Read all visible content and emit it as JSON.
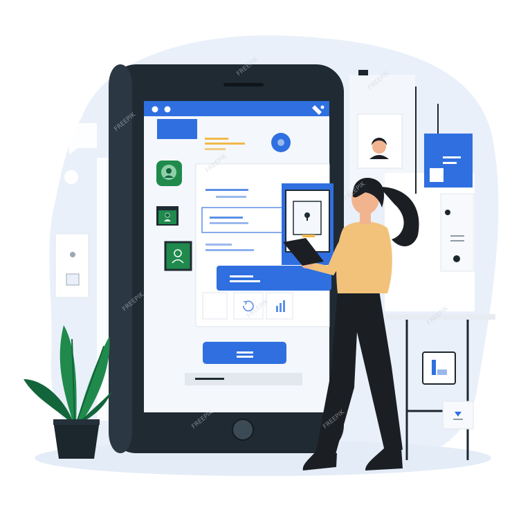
{
  "colors": {
    "background": "#ffffff",
    "backdrop_blob": "#e9f0fa",
    "phone_body": "#1f2a33",
    "phone_edge": "#2b3742",
    "screen": "#f4f7fb",
    "accent_blue": "#2f6fe0",
    "light_blue": "#5b8fe8",
    "line_grey": "#c9d2dc",
    "yellow_accent": "#f2b84b",
    "plant_green": "#1f8a4c",
    "plant_dark": "#12653a",
    "pot": "#1b262d",
    "shirt": "#f2c27b",
    "skin": "#f1b48f",
    "hair": "#1b1f23",
    "pants": "#1b1f23",
    "floor_shadow": "#e4ecf7"
  },
  "icons": {
    "status_dots": "window-dots-icon",
    "signal": "signal-icon",
    "profile_badge": "user-icon",
    "chat_card": "user-icon",
    "contact_card": "user-icon",
    "refresh": "refresh-icon",
    "chart": "bar-chart-icon",
    "lock": "lock-icon",
    "home_button": "home-button-icon"
  },
  "watermark": {
    "text": "FREEPIK"
  }
}
